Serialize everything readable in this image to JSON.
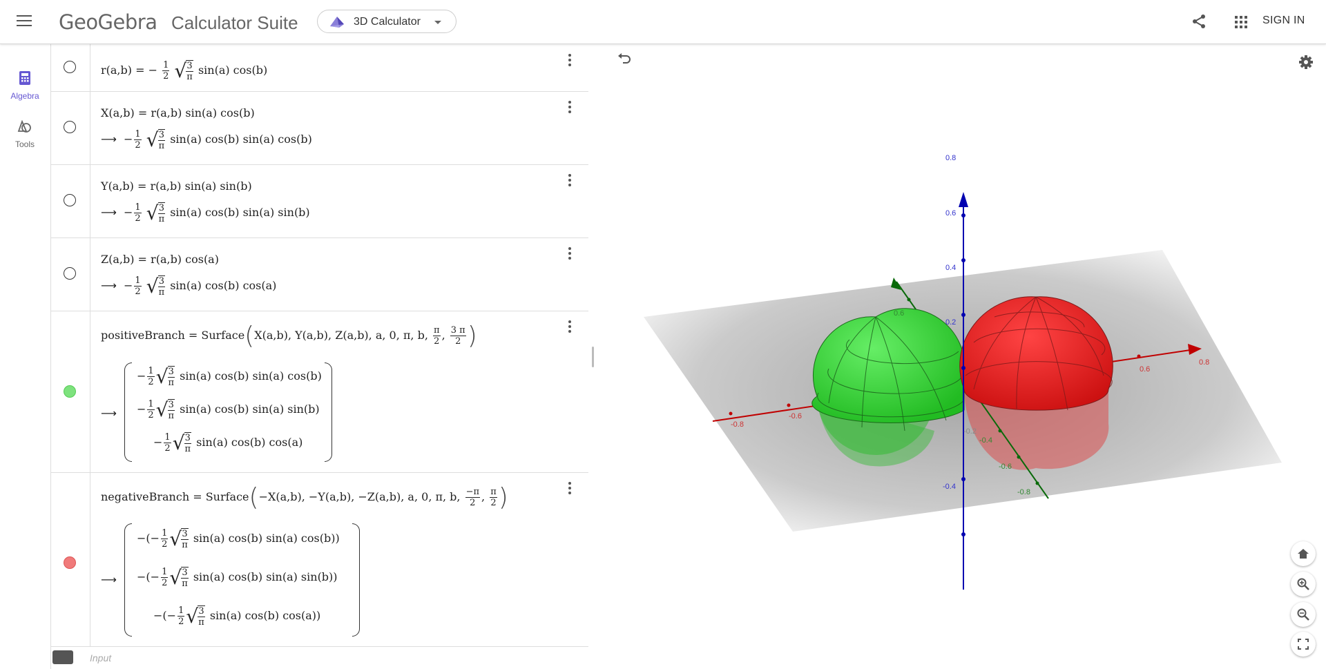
{
  "header": {
    "logo": "GeoGebra",
    "suite": "Calculator Suite",
    "app_picker": "3D Calculator",
    "signin": "SIGN IN"
  },
  "sidenav": {
    "algebra": "Algebra",
    "tools": "Tools"
  },
  "colors": {
    "accent": "#6557d2",
    "green_surface": "#33cc33",
    "red_surface": "#e02020",
    "x_axis": "#c00000",
    "y_axis": "#007000",
    "z_axis": "#0000b0"
  },
  "algebra": {
    "rows": [
      {
        "def": "r(a,b) = −",
        "def_rest": "sin(a) cos(b)"
      },
      {
        "def": "X(a,b) = r(a,b) sin(a) cos(b)",
        "out_rest": "sin(a) cos(b) sin(a) cos(b)"
      },
      {
        "def": "Y(a,b) = r(a,b) sin(a) sin(b)",
        "out_rest": "sin(a) cos(b) sin(a) sin(b)"
      },
      {
        "def": "Z(a,b) = r(a,b) cos(a)",
        "out_rest": "sin(a) cos(b) cos(a)"
      },
      {
        "def": "positiveBranch = Surface",
        "args": "X(a,b), Y(a,b), Z(a,b), a, 0, π, b,",
        "m1": "sin(a) cos(b) sin(a) cos(b)",
        "m2": "sin(a) cos(b) sin(a) sin(b)",
        "m3": "sin(a) cos(b) cos(a)"
      },
      {
        "def": "negativeBranch = Surface",
        "args": "−X(a,b), −Y(a,b), −Z(a,b), a, 0, π, b,",
        "m1": "sin(a) cos(b) sin(a) cos(b)",
        "m2": "sin(a) cos(b) sin(a) sin(b)",
        "m3": "sin(a) cos(b) cos(a)"
      }
    ],
    "input_placeholder": "Input"
  },
  "axes_labels": {
    "z": [
      "0.8",
      "0.6",
      "0.4",
      "0.2",
      "0.2",
      "-0.4"
    ],
    "x": [
      "-0.8",
      "-0.6",
      "0.6",
      "0.8"
    ],
    "y": [
      "0.6",
      "-0.4",
      "-0.6",
      "-0.8"
    ],
    "z_neg": "-0.2"
  }
}
